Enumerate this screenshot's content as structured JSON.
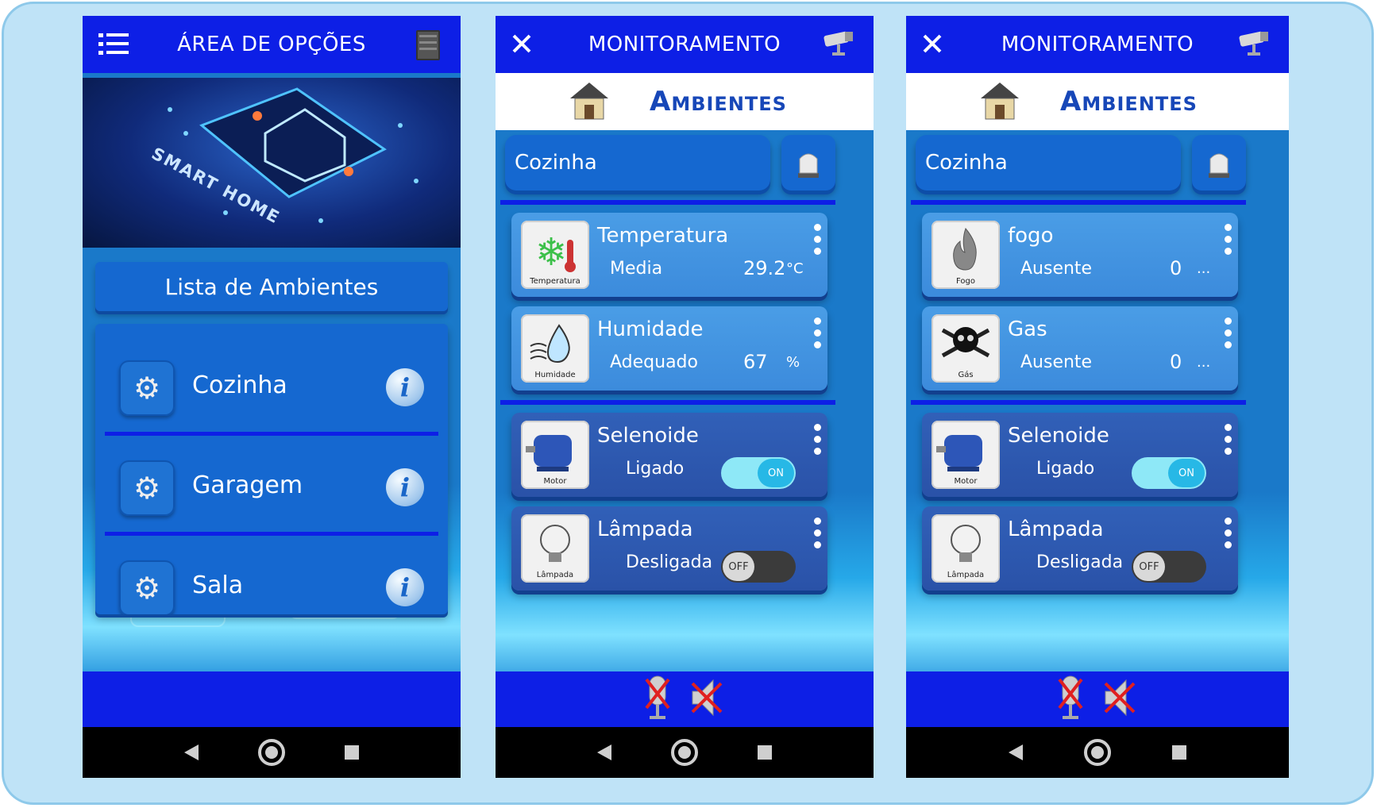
{
  "screen1": {
    "title": "ÁREA DE OPÇÕES",
    "hero_text": "SMART HOME",
    "list_header": "Lista de Ambientes",
    "environments": [
      {
        "name": "Cozinha"
      },
      {
        "name": "Garagem"
      },
      {
        "name": "Sala"
      }
    ],
    "icons": {
      "menu": "menu-icon",
      "right": "server-icon",
      "settings": "gear-icon",
      "info": "info-icon"
    }
  },
  "screen2": {
    "title": "MONITORAMENTO",
    "section": "Ambientes",
    "room": "Cozinha",
    "sensors": [
      {
        "title": "Temperatura",
        "status": "Media",
        "value": "29.2",
        "unit": "°C",
        "tile_caption": "Temperatura"
      },
      {
        "title": "Humidade",
        "status": "Adequado",
        "value": "67",
        "unit": "%",
        "tile_caption": "Humidade"
      }
    ],
    "actuators": [
      {
        "title": "Selenoide",
        "status": "Ligado",
        "toggle": "ON",
        "tile_caption": "Motor"
      },
      {
        "title": "Lâmpada",
        "status": "Desligada",
        "toggle": "OFF",
        "tile_caption": "Lâmpada"
      }
    ]
  },
  "screen3": {
    "title": "MONITORAMENTO",
    "section": "Ambientes",
    "room": "Cozinha",
    "sensors": [
      {
        "title": "fogo",
        "status": "Ausente",
        "value": "0",
        "unit": "...",
        "tile_caption": "Fogo"
      },
      {
        "title": "Gas",
        "status": "Ausente",
        "value": "0",
        "unit": "...",
        "tile_caption": "Gás"
      }
    ],
    "actuators": [
      {
        "title": "Selenoide",
        "status": "Ligado",
        "toggle": "ON",
        "tile_caption": "Motor"
      },
      {
        "title": "Lâmpada",
        "status": "Desligada",
        "toggle": "OFF",
        "tile_caption": "Lâmpada"
      }
    ]
  },
  "colors": {
    "bar": "#0d1fe6",
    "panel": "#1568d0",
    "frame": "#bfe3f7"
  }
}
